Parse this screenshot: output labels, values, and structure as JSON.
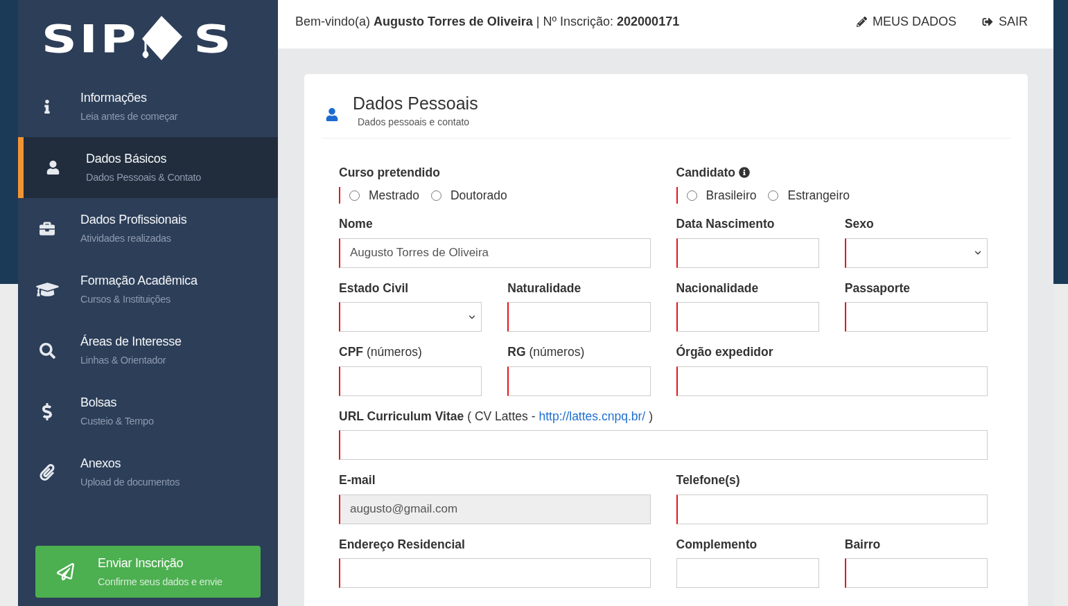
{
  "sidebar": {
    "logo": {
      "text_before": "SIP",
      "text_after": "S"
    },
    "items": [
      {
        "title": "Informações",
        "subtitle": "Leia antes de começar",
        "selected": false
      },
      {
        "title": "Dados Básicos",
        "subtitle": "Dados Pessoais & Contato",
        "selected": true
      },
      {
        "title": "Dados Profissionais",
        "subtitle": "Atividades realizadas",
        "selected": false
      },
      {
        "title": "Formação Acadêmica",
        "subtitle": "Cursos & Instituições",
        "selected": false
      },
      {
        "title": "Áreas de Interesse",
        "subtitle": "Linhas & Orientador",
        "selected": false
      },
      {
        "title": "Bolsas",
        "subtitle": "Custeio & Tempo",
        "selected": false
      },
      {
        "title": "Anexos",
        "subtitle": "Upload de documentos",
        "selected": false
      }
    ],
    "submit": {
      "title": "Enviar Inscrição",
      "subtitle": "Confirme seus dados e envie"
    }
  },
  "header": {
    "welcome": "Bem-vindo(a) **Augusto Torres de Oliveira** | Nº Inscrição: **202000171**",
    "actions": [
      {
        "label": "MEUS DADOS"
      },
      {
        "label": "SAIR"
      }
    ]
  },
  "card": {
    "title": "Dados Pessoais",
    "subtitle": "Dados pessoais e contato"
  },
  "fields": [
    {
      "kind": "radio",
      "label": "Curso pretendido",
      "required": true,
      "options": [
        {
          "label": "Mestrado",
          "selected": false
        },
        {
          "label": "Doutorado",
          "selected": false
        }
      ]
    },
    {
      "kind": "radio",
      "label": "Candidato",
      "help_icon": true,
      "required": true,
      "options": [
        {
          "label": "Brasileiro",
          "selected": false
        },
        {
          "label": "Estrangeiro",
          "selected": false
        }
      ]
    },
    {
      "kind": "text",
      "label": "Nome",
      "required": true,
      "disabled": false,
      "value": "Augusto Torres de Oliveira"
    },
    {
      "kind": "text",
      "label": "Data Nascimento",
      "required": true,
      "disabled": false
    },
    {
      "kind": "select",
      "label": "Sexo",
      "required": true,
      "disabled": false
    },
    {
      "kind": "select",
      "label": "Estado Civil",
      "required": true,
      "disabled": false
    },
    {
      "kind": "text",
      "label": "Naturalidade",
      "required": true,
      "disabled": false
    },
    {
      "kind": "text",
      "label": "Nacionalidade",
      "required": true,
      "disabled": false
    },
    {
      "kind": "text",
      "label": "Passaporte",
      "required": true,
      "disabled": false
    },
    {
      "kind": "text",
      "label": "CPF",
      "note": "(números)",
      "required": true,
      "disabled": false
    },
    {
      "kind": "text",
      "label": "RG",
      "note": "(números)",
      "required": true,
      "disabled": false
    },
    {
      "kind": "text",
      "label": "Órgão expedidor",
      "required": true,
      "disabled": false
    },
    {
      "kind": "text",
      "label": "URL Curriculum Vitae",
      "note": "( CV Lattes -",
      "link": "http://lattes.cnpq.br/",
      "note_after": ")",
      "required": true,
      "disabled": false
    },
    {
      "kind": "text",
      "label": "E-mail",
      "required": true,
      "disabled": true,
      "value": "augusto@gmail.com"
    },
    {
      "kind": "text",
      "label": "Telefone(s)",
      "required": true,
      "disabled": false
    },
    {
      "kind": "text",
      "label": "Endereço Residencial",
      "required": true,
      "disabled": false
    },
    {
      "kind": "text",
      "label": "Complemento",
      "required": false,
      "disabled": false
    },
    {
      "kind": "text",
      "label": "Bairro",
      "required": true,
      "disabled": false
    }
  ]
}
